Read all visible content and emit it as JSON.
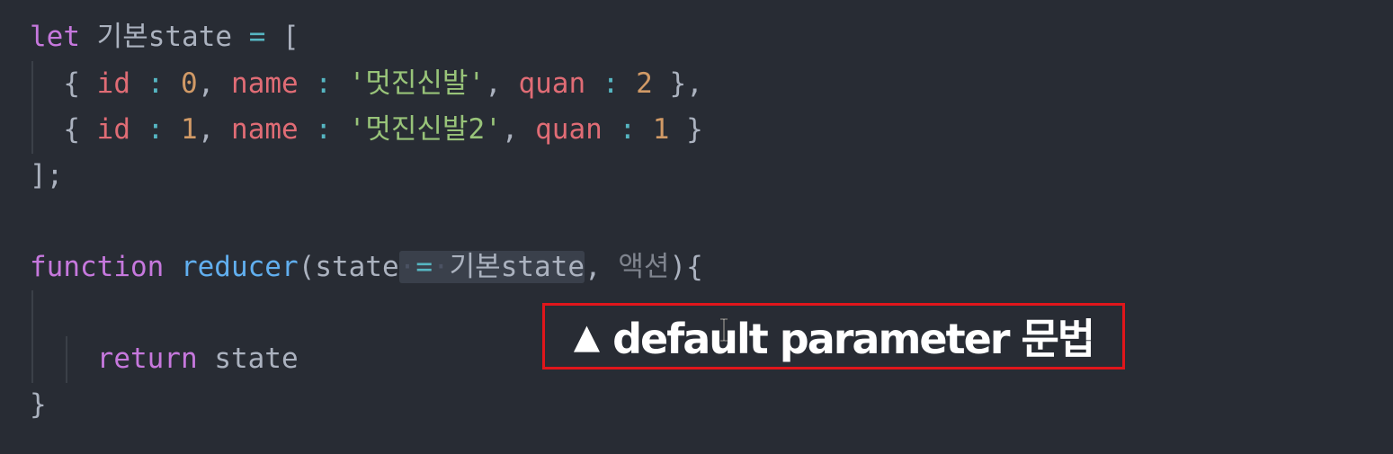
{
  "code": {
    "line1": {
      "kw": "let",
      "name": "기본state",
      "eq": "=",
      "open": "["
    },
    "line2": {
      "open": "{",
      "id_key": "id",
      "colon1": ":",
      "id_val": "0",
      "comma1": ",",
      "name_key": "name",
      "colon2": ":",
      "name_val": "'멋진신발'",
      "comma2": ",",
      "quan_key": "quan",
      "colon3": ":",
      "quan_val": "2",
      "close": "},"
    },
    "line3": {
      "open": "{",
      "id_key": "id",
      "colon1": ":",
      "id_val": "1",
      "comma1": ",",
      "name_key": "name",
      "colon2": ":",
      "name_val": "'멋진신발2'",
      "comma2": ",",
      "quan_key": "quan",
      "colon3": ":",
      "quan_val": "1",
      "close": "}"
    },
    "line4": {
      "close": "];"
    },
    "line6": {
      "kw": "function",
      "fn": "reducer",
      "paren_open": "(",
      "param1": "state",
      "eq": "=",
      "default_val": "기본state",
      "comma": ",",
      "param2": "액션",
      "paren_close": "){"
    },
    "line8": {
      "kw": "return",
      "value": "state"
    },
    "line9": {
      "close": "}"
    }
  },
  "caption": {
    "triangle": "▲",
    "text": "default parameter 문법"
  },
  "colors": {
    "background": "#282c34",
    "keyword": "#c678dd",
    "function": "#61afef",
    "property": "#e06c75",
    "number": "#d19a66",
    "string": "#98c379",
    "operator": "#56b6c2",
    "caption_border": "#e0161b"
  }
}
